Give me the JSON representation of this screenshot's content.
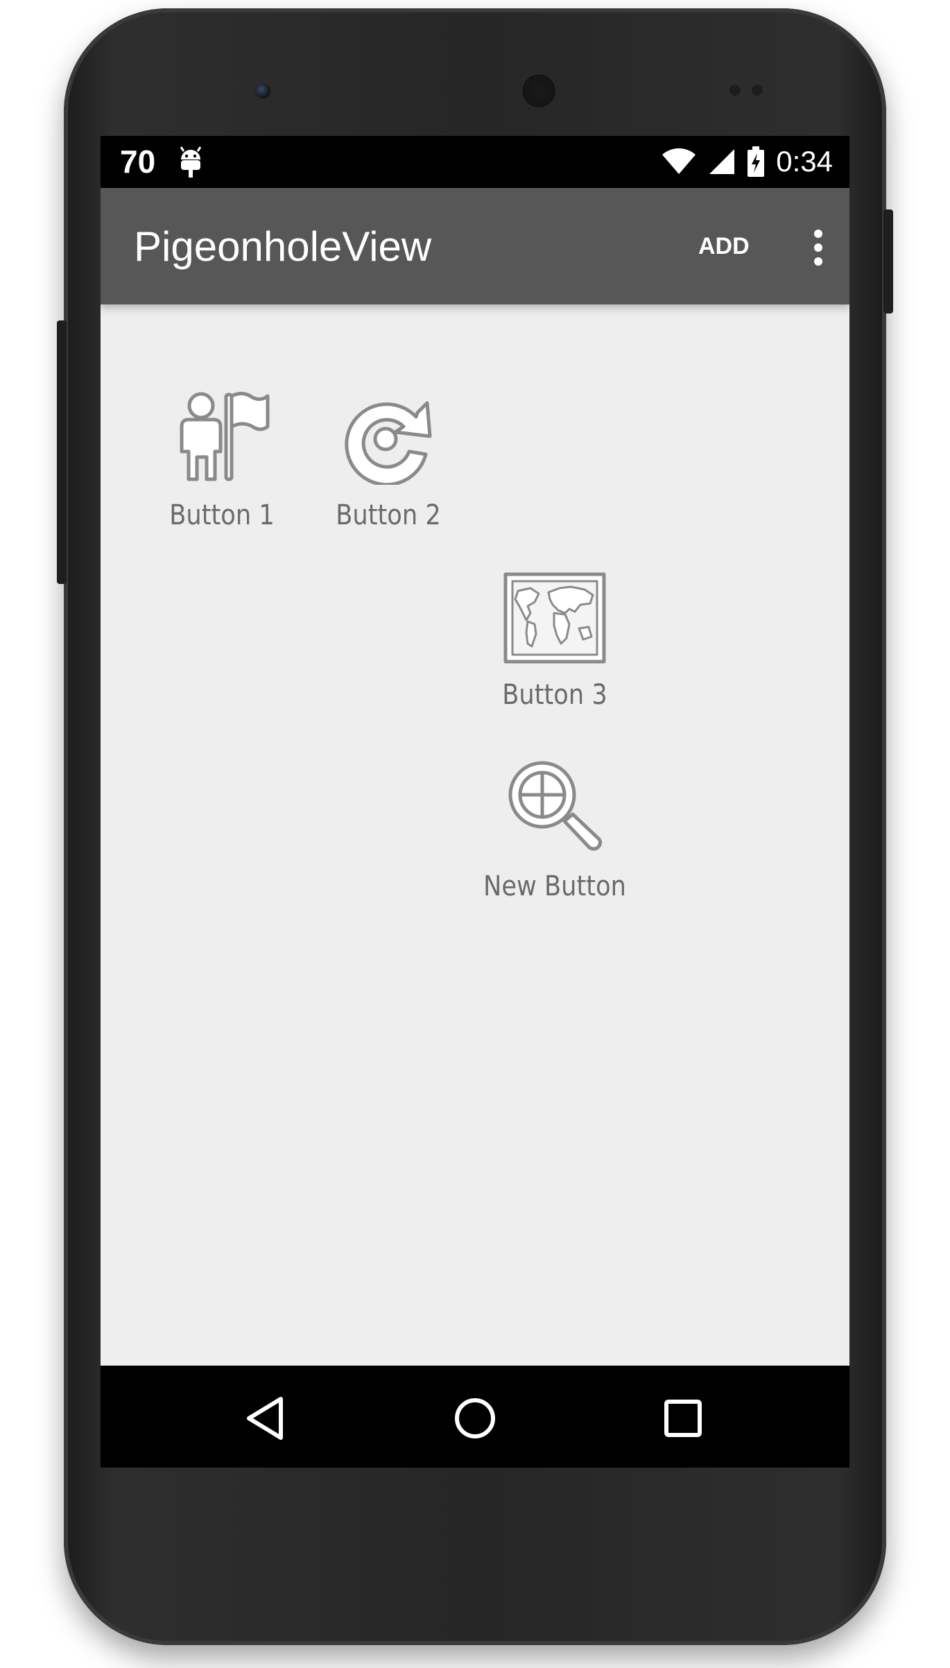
{
  "status_bar": {
    "notification_count": "70",
    "notification_icon": "android-debug-icon",
    "wifi_icon": "wifi-icon",
    "signal_icon": "cell-signal-icon",
    "battery_icon": "battery-charging-icon",
    "time": "0:34"
  },
  "toolbar": {
    "title": "PigeonholeView",
    "add_label": "ADD",
    "overflow_icon": "overflow-menu-icon",
    "background_color": "#575757"
  },
  "grid_buttons": [
    {
      "label": "Button 1",
      "icon": "person-flag-icon"
    },
    {
      "label": "Button 2",
      "icon": "refresh-target-icon"
    },
    {
      "label": "Button 3",
      "icon": "world-map-icon"
    },
    {
      "label": "New Button",
      "icon": "zoom-in-icon"
    }
  ],
  "nav_bar": {
    "back_icon": "back-triangle-icon",
    "home_icon": "home-circle-icon",
    "recents_icon": "recents-square-icon"
  },
  "colors": {
    "content_background": "#eeeeee",
    "label_color": "#6a6a6a",
    "icon_stroke": "#8a8a8a"
  }
}
